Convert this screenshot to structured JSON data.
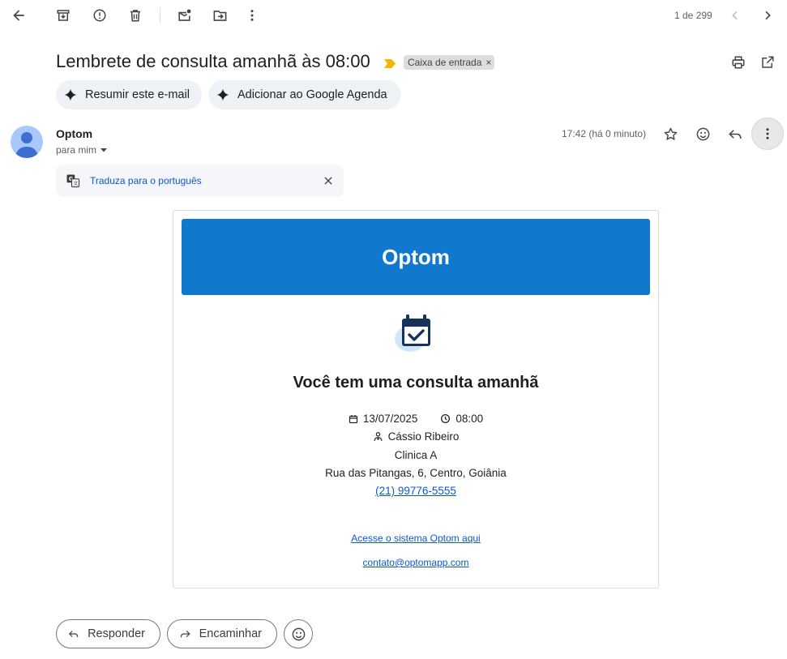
{
  "toolbar": {
    "page_counter": "1 de 299"
  },
  "subject": {
    "title": "Lembrete de consulta amanhã às 08:00",
    "label": "Caixa de entrada",
    "label_remove": "×"
  },
  "ai_actions": {
    "summarize": "Resumir este e-mail",
    "add_calendar": "Adicionar ao Google Agenda"
  },
  "message": {
    "sender": "Optom",
    "to": "para mim",
    "time": "17:42 (há 0 minuto)"
  },
  "translate": {
    "text": "Traduza para o português"
  },
  "email_body": {
    "brand": "Optom",
    "heading": "Você tem uma consulta amanhã",
    "date": "13/07/2025",
    "time": "08:00",
    "doctor": "Cássio Ribeiro",
    "clinic": "Clinica A",
    "address": "Rua das Pitangas, 6, Centro, Goiânia",
    "phone": "(21) 99776-5555",
    "system_link": "Acesse o sistema Optom aqui",
    "contact_email": "contato@optomapp.com"
  },
  "actions": {
    "reply": "Responder",
    "forward": "Encaminhar"
  },
  "colors": {
    "banner": "#1179cd",
    "link": "#0b57d0",
    "label_chevron": "#f4b400"
  }
}
